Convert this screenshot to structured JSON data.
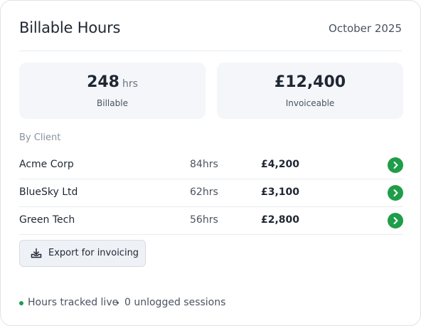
{
  "header": {
    "title": "Billable Hours",
    "period": "October 2025"
  },
  "stats": [
    {
      "value": "248",
      "unit": "hrs",
      "label": "Billable"
    },
    {
      "value": "£12,400",
      "unit": "",
      "label": "Invoiceable"
    }
  ],
  "by_client": {
    "label": "By Client",
    "rows": [
      {
        "name": "Acme Corp",
        "hours": "84hrs",
        "amount": "£4,200"
      },
      {
        "name": "BlueSky Ltd",
        "hours": "62hrs",
        "amount": "£3,100"
      },
      {
        "name": "Green Tech",
        "hours": "56hrs",
        "amount": "£2,800"
      }
    ]
  },
  "export_button": {
    "label": "Export for invoicing",
    "icon": "download-tray-icon"
  },
  "footer": {
    "status_text": "Hours tracked live",
    "unlogged_text": "0 unlogged sessions",
    "status_color": "#1f9d49"
  },
  "colors": {
    "accent": "#1f9d49",
    "stat_background": "#f4f6f9"
  }
}
